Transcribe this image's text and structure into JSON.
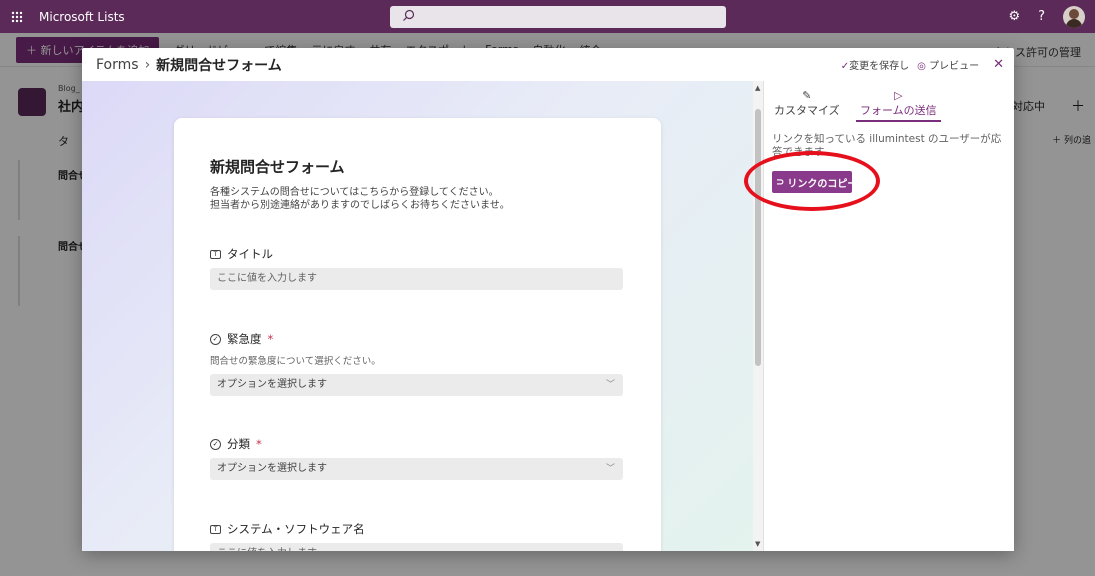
{
  "suite": {
    "app_name": "Microsoft Lists",
    "icons": [
      "waffle-icon",
      "search-icon",
      "settings-icon",
      "help-icon"
    ],
    "help_glyph": "?",
    "settings_glyph": "⚙"
  },
  "background": {
    "new_item": "＋ 新しいアイテムを追加",
    "cmd_items": [
      "グリッドビュー",
      "で編集",
      "元に戻す",
      "共有",
      "エクスポート",
      "Forms",
      "自動化",
      "統合"
    ],
    "cmd_right": "アクセス許可の管理",
    "list_small": "Blog_",
    "list_title": "社内",
    "col_header": "タ",
    "row1": "問合せ",
    "row2": "問合せ",
    "right_filter": "対応中",
    "add_column": "＋ 列の追"
  },
  "dialog": {
    "crumb_root": "Forms",
    "crumb_sep": "›",
    "crumb_current": "新規問合せフォーム",
    "save_label": "変更を保存し",
    "preview_label": "プレビュー",
    "close_glyph": "✕"
  },
  "form": {
    "title": "新規問合せフォーム",
    "description": "各種システムの問合せについてはこちらから登録してください。\n担当者から別途連絡がありますのでしばらくお待ちくださいませ。",
    "questions": [
      {
        "label": "タイトル",
        "placeholder": "ここに値を入力します"
      },
      {
        "label": "緊急度",
        "required": "*",
        "subtext": "問合せの緊急度について選択ください。",
        "placeholder": "オプションを選択します"
      },
      {
        "label": "分類",
        "required": "*",
        "placeholder": "オプションを選択します"
      },
      {
        "label": "システム・ソフトウェア名",
        "placeholder": "ここに値を入力します"
      }
    ]
  },
  "side_panel": {
    "tab_customize": "カスタマイズ",
    "tab_send": "フォームの送信",
    "share_text": "リンクを知っている illumintest のユーザーが応答できます",
    "copy_link": "リンクのコピー"
  },
  "colors": {
    "brand": "#5b2a59",
    "accent": "#7a2d7a",
    "annotation": "#e5101b"
  }
}
